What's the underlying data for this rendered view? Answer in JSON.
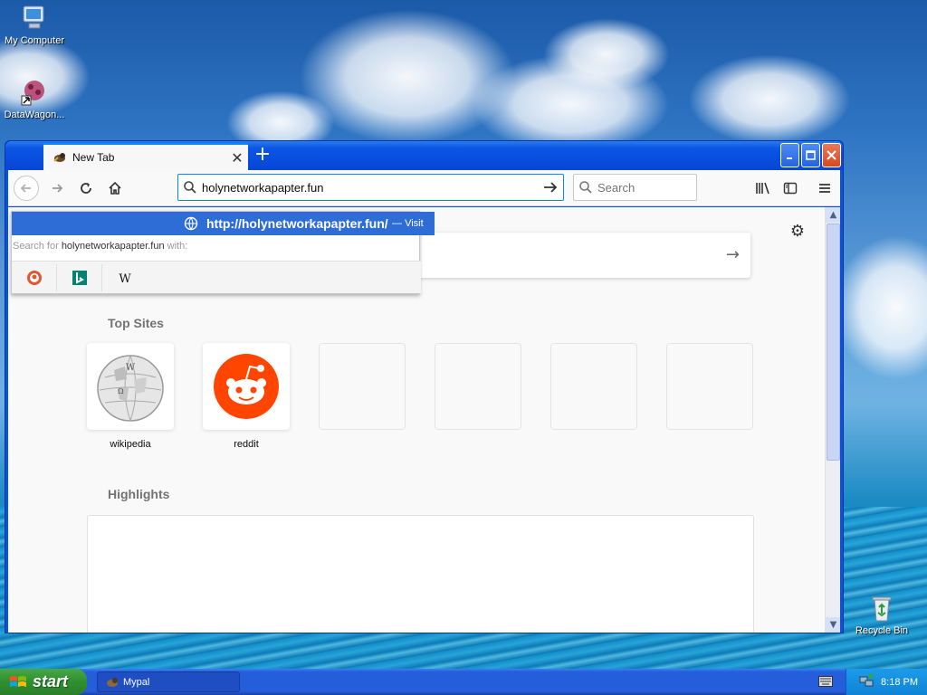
{
  "desktop": {
    "icons": [
      {
        "label": "My Computer"
      },
      {
        "label": "DataWagon..."
      },
      {
        "label": "Recycle Bin"
      }
    ]
  },
  "window": {
    "tab": {
      "title": "New Tab"
    },
    "address": {
      "value": "holynetworkapapter.fun"
    },
    "search": {
      "placeholder": "Search"
    }
  },
  "urlbar_popup": {
    "url": "http://holynetworkapapter.fun/",
    "dash": "—",
    "visit": "Visit",
    "search_for_prefix": "Search for",
    "search_for_query": "holynetworkapapter.fun",
    "search_for_suffix": "with:",
    "engines": [
      "DuckDuckGo",
      "Bing",
      "Wikipedia"
    ]
  },
  "newtab": {
    "top_sites_title": "Top Sites",
    "top_sites": [
      {
        "label": "wikipedia"
      },
      {
        "label": "reddit"
      }
    ],
    "highlights_title": "Highlights"
  },
  "taskbar": {
    "start_label": "start",
    "items": [
      {
        "label": "Mypal"
      }
    ],
    "clock": "8:18 PM"
  },
  "colors": {
    "accent": "#0a84ff",
    "popup_highlight": "#2e6dd6",
    "reddit": "#ff4500",
    "xp_blue": "#245edb",
    "start_green": "#2f8f2f"
  }
}
